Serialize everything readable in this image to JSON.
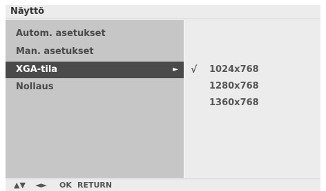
{
  "title": "Näyttö",
  "menu": {
    "items": [
      {
        "label": "Autom. asetukset"
      },
      {
        "label": "Man. asetukset"
      },
      {
        "label": "XGA-tila",
        "arrow": "►"
      },
      {
        "label": "Nollaus"
      }
    ]
  },
  "options": {
    "items": [
      {
        "label": "1024x768",
        "check": "√"
      },
      {
        "label": "1280x768"
      },
      {
        "label": "1360x768"
      }
    ]
  },
  "footer": {
    "updown": "▲▼",
    "leftright": "◄►",
    "ok": "OK",
    "return": "RETURN"
  },
  "colors": {
    "title_bg": "#ececec",
    "left_panel": "#c6c6c6",
    "right_panel": "#ececec",
    "selected_bg": "#4a4a4a",
    "text": "#4a4a4a"
  }
}
